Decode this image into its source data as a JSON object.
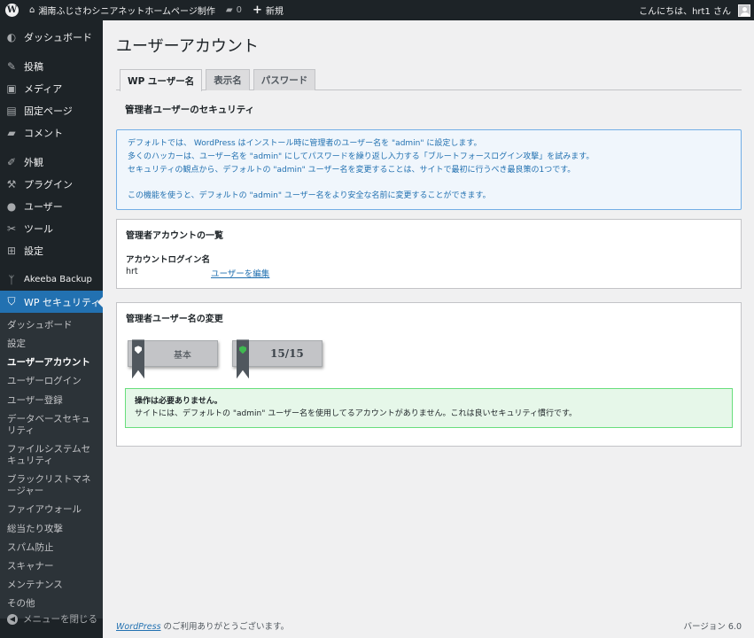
{
  "adminbar": {
    "site_name": "湘南ふじさわシニアネットホームページ制作",
    "comments_count": "0",
    "new_label": "新規",
    "greeting": "こんにちは、hrt1 さん"
  },
  "sidebar": {
    "items": [
      {
        "label": "ダッシュボード",
        "icon": "dashboard-icon",
        "glyph": "◐"
      },
      {
        "label": "投稿",
        "icon": "pin-icon",
        "glyph": "✎"
      },
      {
        "label": "メディア",
        "icon": "media-icon",
        "glyph": "▣"
      },
      {
        "label": "固定ページ",
        "icon": "page-icon",
        "glyph": "▤"
      },
      {
        "label": "コメント",
        "icon": "comment-icon",
        "glyph": "▰"
      },
      {
        "label": "外観",
        "icon": "appearance-icon",
        "glyph": "✐"
      },
      {
        "label": "プラグイン",
        "icon": "plugin-icon",
        "glyph": "⚒"
      },
      {
        "label": "ユーザー",
        "icon": "user-icon",
        "glyph": "●"
      },
      {
        "label": "ツール",
        "icon": "tool-icon",
        "glyph": "✂"
      },
      {
        "label": "設定",
        "icon": "settings-icon",
        "glyph": "⊞"
      },
      {
        "label": "Akeeba Backup",
        "icon": "akeeba-icon",
        "glyph": "ᛉ"
      },
      {
        "label": "WP セキュリティ",
        "icon": "shield-icon",
        "glyph": "⛉"
      }
    ],
    "submenu": [
      "ダッシュボード",
      "設定",
      "ユーザーアカウント",
      "ユーザーログイン",
      "ユーザー登録",
      "データベースセキュリティ",
      "ファイルシステムセキュリティ",
      "ブラックリストマネージャー",
      "ファイアウォール",
      "総当たり攻撃",
      "スパム防止",
      "スキャナー",
      "メンテナンス",
      "その他"
    ],
    "collapse_label": "メニューを閉じる"
  },
  "main": {
    "title": "ユーザーアカウント",
    "tabs": [
      "WP ユーザー名",
      "表示名",
      "パスワード"
    ],
    "section_title": "管理者ユーザーのセキュリティ",
    "notice": [
      "デフォルトでは、 WordPress はインストール時に管理者のユーザー名を \"admin\" に設定します。",
      "多くのハッカーは、ユーザー名を \"admin\" にしてパスワードを繰り返し入力する「ブルートフォースログイン攻撃」を試みます。",
      "セキュリティの観点から、デフォルトの \"admin\" ユーザー名を変更することは、サイトで最初に行うべき最良策の1つです。",
      "この機能を使うと、デフォルトの \"admin\" ユーザー名をより安全な名前に変更することができます。"
    ],
    "accounts_box": {
      "title": "管理者アカウントの一覧",
      "column_header": "アカウントログイン名",
      "username": "hrt",
      "edit_link": "ユーザーを編集"
    },
    "change_box": {
      "title": "管理者ユーザー名の変更",
      "badge_basic": "基本",
      "badge_score": "15/15",
      "ok_title": "操作は必要ありません。",
      "ok_text": "サイトには、デフォルトの \"admin\" ユーザー名を使用してるアカウントがありません。これは良いセキュリティ慣行です。"
    }
  },
  "footer": {
    "wp_link": "WordPress",
    "thanks": " のご利用ありがとうございます。",
    "version": "バージョン 6.0"
  }
}
